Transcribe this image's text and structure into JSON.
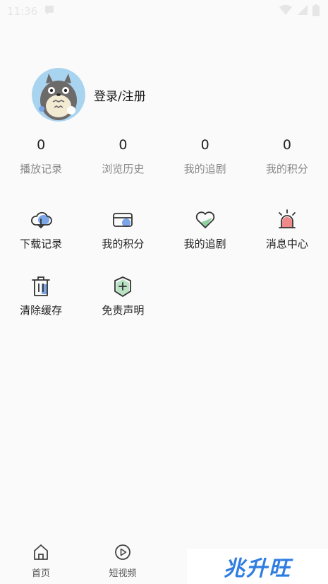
{
  "status_bar": {
    "time": "11:36"
  },
  "profile": {
    "login_label": "登录/注册"
  },
  "stats": [
    {
      "value": "0",
      "label": "播放记录"
    },
    {
      "value": "0",
      "label": "浏览历史"
    },
    {
      "value": "0",
      "label": "我的追剧"
    },
    {
      "value": "0",
      "label": "我的积分"
    }
  ],
  "menu": [
    {
      "label": "下载记录",
      "icon": "cloud-download-icon"
    },
    {
      "label": "我的积分",
      "icon": "card-icon"
    },
    {
      "label": "我的追剧",
      "icon": "heart-icon"
    },
    {
      "label": "消息中心",
      "icon": "alarm-icon"
    },
    {
      "label": "清除缓存",
      "icon": "trash-icon"
    },
    {
      "label": "免责声明",
      "icon": "shield-plus-icon"
    }
  ],
  "bottom_nav": [
    {
      "label": "首页",
      "icon": "home-icon"
    },
    {
      "label": "短视频",
      "icon": "play-icon"
    }
  ],
  "watermark": {
    "text": "兆升旺"
  },
  "colors": {
    "accent_blue": "#7aa6e8",
    "accent_green": "#8fd19e",
    "accent_red": "#f08a8a"
  }
}
